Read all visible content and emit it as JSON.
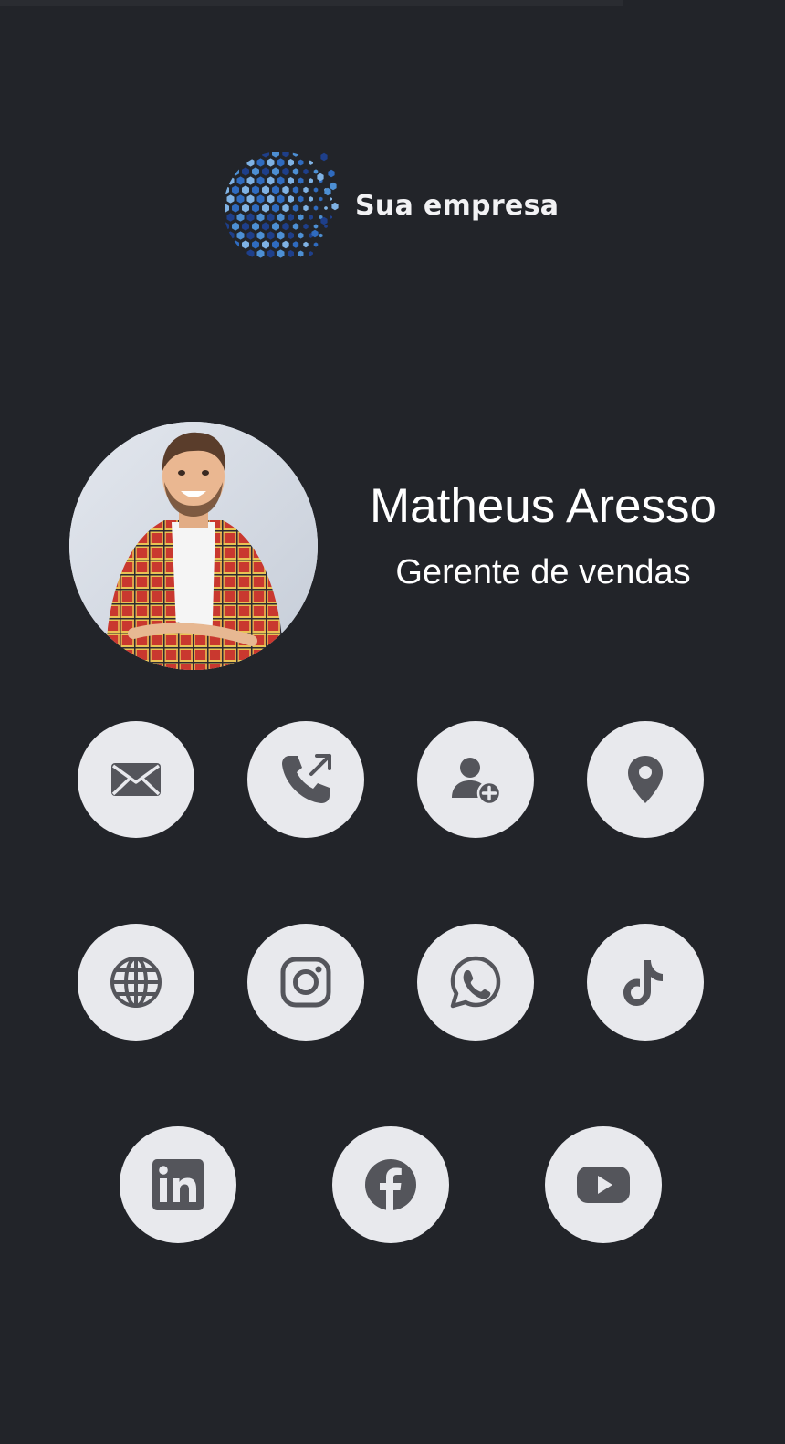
{
  "brand": {
    "logo_text": "Sua empresa",
    "logo_colors": [
      "#1e3f8a",
      "#2f6bbf",
      "#4d8fd3",
      "#7fb2e4"
    ]
  },
  "profile": {
    "name": "Matheus Aresso",
    "role": "Gerente de vendas"
  },
  "theme": {
    "background": "#222429",
    "button_bg": "#e8e9ed",
    "icon_color": "#54555b",
    "text_color": "#ffffff"
  },
  "actions": [
    {
      "id": "email",
      "icon": "envelope-icon"
    },
    {
      "id": "phone",
      "icon": "phone-outgoing-icon"
    },
    {
      "id": "add-contact",
      "icon": "user-plus-icon"
    },
    {
      "id": "location",
      "icon": "map-pin-icon"
    },
    {
      "id": "website",
      "icon": "globe-icon"
    },
    {
      "id": "instagram",
      "icon": "instagram-icon"
    },
    {
      "id": "whatsapp",
      "icon": "whatsapp-icon"
    },
    {
      "id": "tiktok",
      "icon": "tiktok-icon"
    },
    {
      "id": "linkedin",
      "icon": "linkedin-icon"
    },
    {
      "id": "facebook",
      "icon": "facebook-icon"
    },
    {
      "id": "youtube",
      "icon": "youtube-icon"
    }
  ]
}
